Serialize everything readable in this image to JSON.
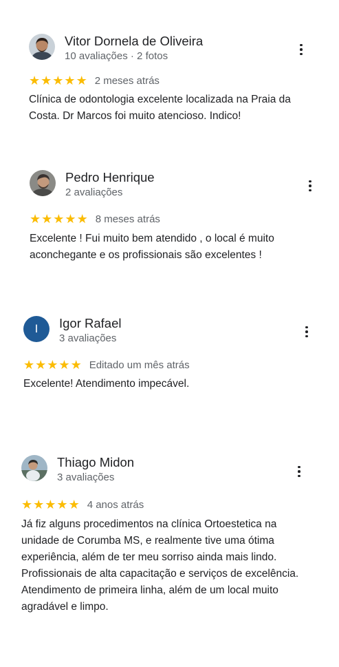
{
  "colors": {
    "star": "#fbbc04",
    "avatar_igor": "#1f5a96",
    "secondary_text": "#5f6368"
  },
  "reviews": [
    {
      "name": "Vitor Dornela de Oliveira",
      "meta": "10 avaliações · 2 fotos",
      "rating": 5,
      "time": "2 meses atrás",
      "text": "Clínica de odontologia excelente localizada na Praia da Costa. Dr Marcos foi muito atencioso. Indico!",
      "avatar": "photo"
    },
    {
      "name": "Pedro Henrique",
      "meta": "2 avaliações",
      "rating": 5,
      "time": "8 meses atrás",
      "text": "Excelente ! Fui muito bem atendido , o local é muito aconchegante e os profissionais são excelentes !",
      "avatar": "photo"
    },
    {
      "name": "Igor Rafael",
      "meta": "3 avaliações",
      "rating": 5,
      "time": "Editado um mês atrás",
      "text": "Excelente! Atendimento impecável.",
      "avatar": "letter",
      "avatar_letter": "I"
    },
    {
      "name": "Thiago Midon",
      "meta": "3 avaliações",
      "rating": 5,
      "time": "4 anos atrás",
      "text": "Já fiz alguns procedimentos na clínica Ortoestetica na unidade de Corumba MS, e realmente tive uma ótima experiência, além de ter meu sorriso ainda mais lindo. Profissionais de alta capacitação e serviços de excelência. Atendimento de primeira linha, além de um local muito agradável e limpo.",
      "avatar": "photo"
    }
  ]
}
